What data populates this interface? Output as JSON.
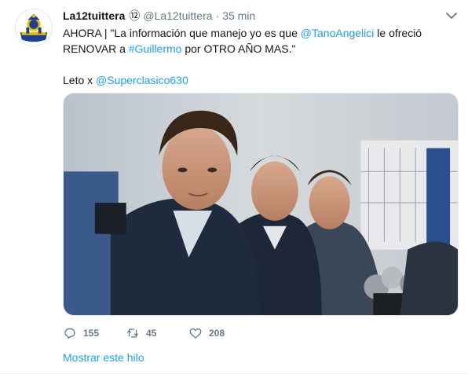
{
  "tweet": {
    "display_name": "La12tuittera",
    "badge": "⑫",
    "handle": "@La12tuittera",
    "separator": "·",
    "time": "35 min",
    "text": {
      "line1_prefix": "AHORA | \"La información que manejo yo es que ",
      "mention_1": "@TanoAngelici",
      "line1_suffix": " le ofreció",
      "line2_prefix": "RENOVAR a ",
      "hashtag": "#Guillermo",
      "line2_suffix": " por OTRO AÑO MAS.\"",
      "credit_prefix": "Leto x ",
      "mention_2": "@Superclasico630"
    },
    "actions": {
      "replies": "155",
      "retweets": "45",
      "likes": "208"
    },
    "thread_link": "Mostrar este hilo"
  },
  "icons": {
    "avatar": "boca-juniors-crest-icon",
    "caret": "chevron-down-icon",
    "reply": "reply-bubble-icon",
    "retweet": "retweet-icon",
    "like": "heart-icon"
  },
  "colors": {
    "link": "#1da1f2",
    "secondary_text": "#657786",
    "primary_text": "#14171a"
  }
}
